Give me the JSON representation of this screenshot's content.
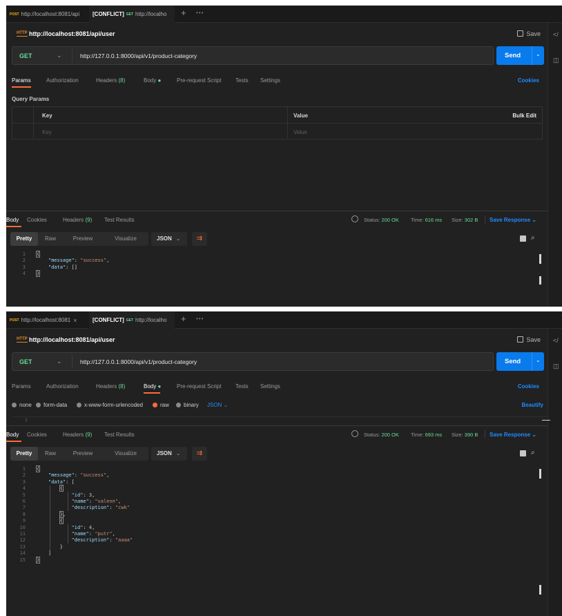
{
  "colors": {
    "accent": "#ff6c37",
    "send": "#097bed",
    "get": "#6bdd9a",
    "post": "#ffb400",
    "link": "#1f8cff",
    "status_ok": "#6bdd9a"
  },
  "icons": {
    "request": "http-icon",
    "save": "save-icon",
    "globe": "globe-icon",
    "copy": "copy-icon",
    "search": "search-icon",
    "wrap": "wrap-lines-icon",
    "code": "code-icon",
    "info": "info-icon"
  },
  "screenshots": [
    {
      "tabs": [
        {
          "method": "POST",
          "url": "http://localhost:8081/api"
        },
        {
          "label": "[CONFLICT]",
          "method": "GET",
          "url": "http://localho"
        }
      ],
      "tab_more": "•••",
      "request_title": "http://localhost:8081/api/user",
      "save_label": "Save",
      "method": "GET",
      "url": "http://127.0.0.1:8000/api/v1/product-category",
      "send_label": "Send",
      "req_tabs": {
        "params": "Params",
        "authorization": "Authorization",
        "headers": "Headers",
        "headers_count": "(8)",
        "body": "Body",
        "pre_request": "Pre-request Script",
        "tests": "Tests",
        "settings": "Settings",
        "cookies": "Cookies"
      },
      "query_params": {
        "title": "Query Params",
        "key_header": "Key",
        "value_header": "Value",
        "bulk_edit": "Bulk Edit",
        "key_placeholder": "Key",
        "value_placeholder": "Value"
      },
      "response": {
        "tabs": {
          "body": "Body",
          "cookies": "Cookies",
          "headers": "Headers",
          "headers_count": "(9)",
          "tests": "Test Results"
        },
        "status_label": "Status:",
        "status": "200 OK",
        "time_label": "Time:",
        "time": "616 ms",
        "size_label": "Size:",
        "size": "302 B",
        "save_response": "Save Response",
        "views": [
          "Pretty",
          "Raw",
          "Preview",
          "Visualize"
        ],
        "format": "JSON",
        "lines": [
          "1",
          "2",
          "3",
          "4"
        ],
        "code": {
          "message_key": "\"message\"",
          "message_val": "\"success\"",
          "data_key": "\"data\"",
          "data_val": "[]"
        }
      }
    },
    {
      "tabs": [
        {
          "method": "POST",
          "url": "http://localhost:8081",
          "close": "×"
        },
        {
          "label": "[CONFLICT]",
          "method": "GET",
          "url": "http://localho"
        }
      ],
      "tab_more": "•••",
      "request_title": "http://localhost:8081/api/user",
      "save_label": "Save",
      "method": "GET",
      "url": "http://127.0.0.1:8000/api/v1/product-category",
      "send_label": "Send",
      "req_tabs": {
        "params": "Params",
        "authorization": "Authorization",
        "headers": "Headers",
        "headers_count": "(8)",
        "body": "Body",
        "pre_request": "Pre-request Script",
        "tests": "Tests",
        "settings": "Settings",
        "cookies": "Cookies"
      },
      "body_modes": {
        "none": "none",
        "form_data": "form-data",
        "urlencoded": "x-www-form-urlencoded",
        "raw": "raw",
        "binary": "binary",
        "json": "JSON",
        "beautify": "Beautify"
      },
      "body_line": "1",
      "response": {
        "tabs": {
          "body": "Body",
          "cookies": "Cookies",
          "headers": "Headers",
          "headers_count": "(9)",
          "tests": "Test Results"
        },
        "status_label": "Status:",
        "status": "200 OK",
        "time_label": "Time:",
        "time": "693 ms",
        "size_label": "Size:",
        "size": "390 B",
        "save_response": "Save Response",
        "views": [
          "Pretty",
          "Raw",
          "Preview",
          "Visualize"
        ],
        "format": "JSON",
        "lines": [
          "1",
          "2",
          "3",
          "4",
          "5",
          "6",
          "7",
          "8",
          "9",
          "10",
          "11",
          "12",
          "13",
          "14",
          "15"
        ],
        "items": [
          {
            "id": "3",
            "name": "\"valenn\"",
            "description": "\"cwk\""
          },
          {
            "id": "4",
            "name": "\"putr\"",
            "description": "\"aaaa\""
          }
        ],
        "code": {
          "message_key": "\"message\"",
          "message_val": "\"success\"",
          "data_key": "\"data\"",
          "id_key": "\"id\"",
          "name_key": "\"name\"",
          "desc_key": "\"description\""
        }
      }
    }
  ]
}
